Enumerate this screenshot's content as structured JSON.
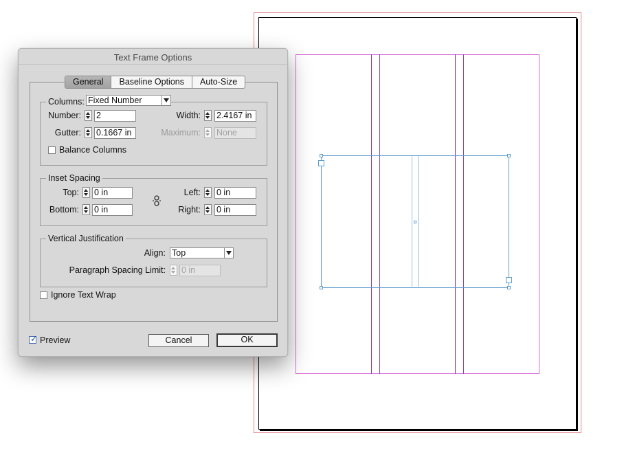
{
  "dialog": {
    "title": "Text Frame Options",
    "tabs": [
      {
        "label": "General",
        "active": true
      },
      {
        "label": "Baseline Options",
        "active": false
      },
      {
        "label": "Auto-Size",
        "active": false
      }
    ],
    "columns": {
      "label": "Columns:",
      "type_value": "Fixed Number",
      "number_label": "Number:",
      "number_value": "2",
      "width_label": "Width:",
      "width_value": "2.4167 in",
      "gutter_label": "Gutter:",
      "gutter_value": "0.1667 in",
      "maximum_label": "Maximum:",
      "maximum_value": "None",
      "balance_label": "Balance Columns",
      "balance_checked": false
    },
    "inset": {
      "title": "Inset Spacing",
      "top_label": "Top:",
      "top_value": "0 in",
      "bottom_label": "Bottom:",
      "bottom_value": "0 in",
      "left_label": "Left:",
      "left_value": "0 in",
      "right_label": "Right:",
      "right_value": "0 in",
      "link_icon": "chain-link-icon"
    },
    "vertical": {
      "title": "Vertical Justification",
      "align_label": "Align:",
      "align_value": "Top",
      "para_label": "Paragraph Spacing Limit:",
      "para_value": "0 in"
    },
    "ignore_wrap_label": "Ignore Text Wrap",
    "ignore_wrap_checked": false,
    "preview_label": "Preview",
    "preview_checked": true,
    "cancel_label": "Cancel",
    "ok_label": "OK"
  },
  "colors": {
    "dialog_bg": "#d8d8d8",
    "margin_guide": "#d66ad6",
    "column_guide": "#7a3fc7",
    "bleed_guide": "#e2838c",
    "frame_selection": "#5d9ccc"
  }
}
